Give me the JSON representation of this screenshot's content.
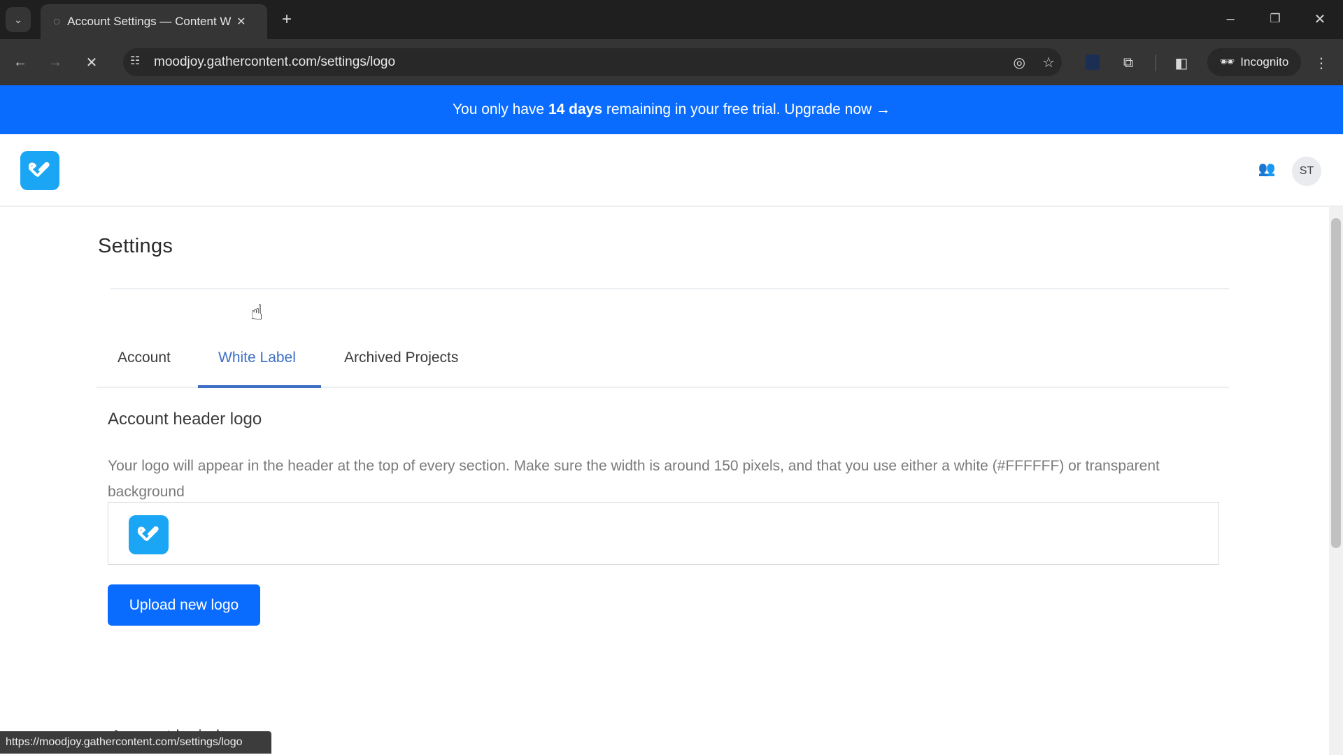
{
  "browser": {
    "tab_title": "Account Settings — Content W",
    "url": "moodjoy.gathercontent.com/settings/logo",
    "incognito_label": "Incognito",
    "status_url": "https://moodjoy.gathercontent.com/settings/logo"
  },
  "banner": {
    "pre": "You only have ",
    "bold": "14 days",
    "post": " remaining in your free trial. ",
    "link": "Upgrade now →"
  },
  "header": {
    "avatar_initials": "ST"
  },
  "page": {
    "title": "Settings",
    "tabs": [
      {
        "label": "Account"
      },
      {
        "label": "White Label",
        "active": true
      },
      {
        "label": "Archived Projects"
      }
    ],
    "section_title": "Account header logo",
    "section_desc": "Your logo will appear in the header at the top of every section. Make sure the width is around 150 pixels, and that you use either a white (#FFFFFF) or transparent background",
    "upload_label": "Upload new logo",
    "next_section_title": "Account login logo"
  },
  "colors": {
    "accent": "#0a6cff",
    "logo": "#1aa6f5"
  }
}
